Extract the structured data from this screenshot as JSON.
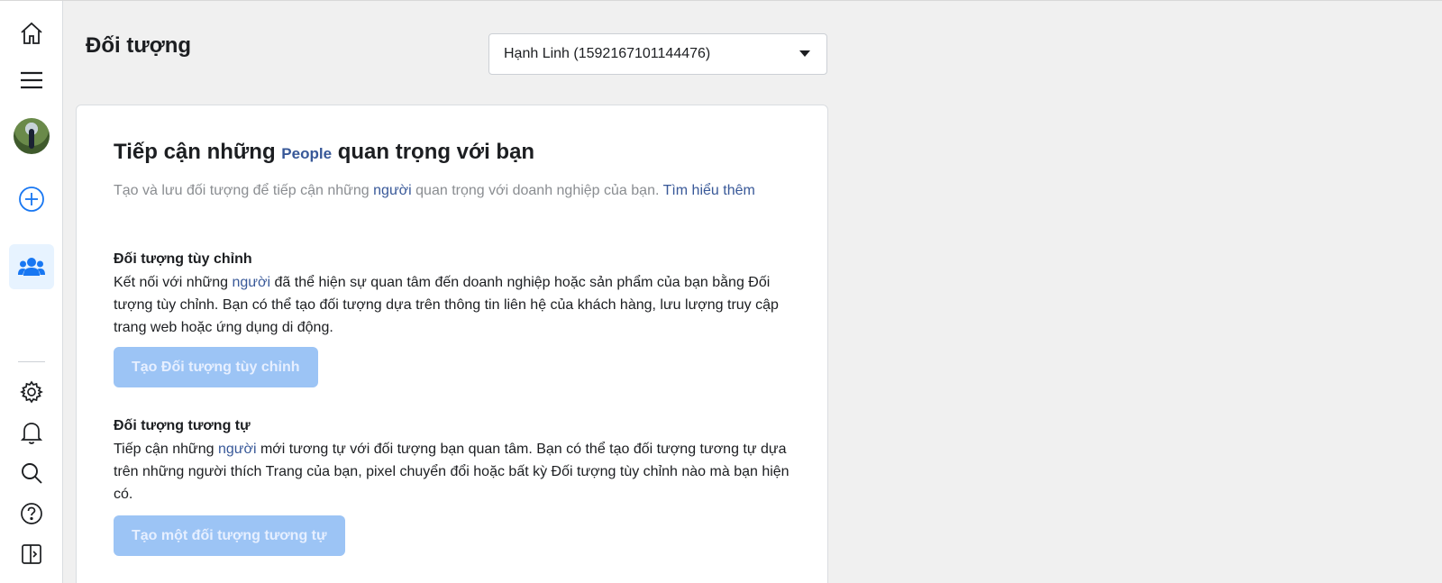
{
  "sidebar": {
    "items": [
      {
        "icon": "home-icon"
      },
      {
        "icon": "menu-icon"
      },
      {
        "icon": "avatar"
      },
      {
        "icon": "add-icon"
      },
      {
        "icon": "people-icon",
        "active": true
      },
      {
        "icon": "gear-icon"
      },
      {
        "icon": "bell-icon"
      },
      {
        "icon": "search-icon"
      },
      {
        "icon": "help-icon"
      },
      {
        "icon": "panel-toggle-icon"
      }
    ]
  },
  "header": {
    "title": "Đối tượng",
    "account_select": {
      "value": "Hạnh Linh (1592167101144476)"
    }
  },
  "card": {
    "heading_before": "Tiếp cận những ",
    "heading_highlight": "People",
    "heading_after": " quan trọng với bạn",
    "intro_before": "Tạo và lưu đối tượng để tiếp cận những ",
    "intro_highlight": "người",
    "intro_after": " quan trọng với doanh nghiệp của bạn. ",
    "intro_link": "Tìm hiểu thêm",
    "custom": {
      "title": "Đối tượng tùy chỉnh",
      "text_before": "Kết nối với những ",
      "text_highlight": "người",
      "text_after": " đã thể hiện sự quan tâm đến doanh nghiệp hoặc sản phẩm của bạn bằng Đối tượng tùy chỉnh. Bạn có thể tạo đối tượng dựa trên thông tin liên hệ của khách hàng, lưu lượng truy cập trang web hoặc ứng dụng di động.",
      "button": "Tạo Đối tượng tùy chỉnh"
    },
    "lookalike": {
      "title": "Đối tượng tương tự",
      "text_before": "Tiếp cận những ",
      "text_highlight": "người",
      "text_after": " mới tương tự với đối tượng bạn quan tâm. Bạn có thể tạo đối tượng tương tự dựa trên những người thích Trang của bạn, pixel chuyển đổi hoặc bất kỳ Đối tượng tùy chỉnh nào mà bạn hiện có.",
      "button": "Tạo một đối tượng tương tự"
    }
  },
  "colors": {
    "accent": "#1877f2",
    "link": "#385898",
    "disabled_button": "#9cc4f5",
    "background": "#f0f0f0"
  }
}
